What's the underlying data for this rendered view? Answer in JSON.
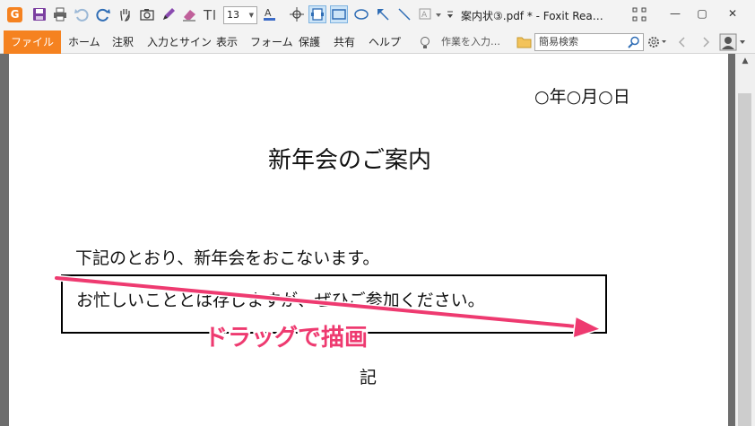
{
  "window": {
    "title": "案内状③.pdf * - Foxit Rea…",
    "font_size": "13"
  },
  "ribbon": {
    "file_tab": "ファイル",
    "tabs": [
      "ホーム",
      "注釈",
      "入力とサイン",
      "表示",
      "フォーム",
      "保護",
      "共有",
      "ヘルプ"
    ],
    "tell_me": "作業を入力…",
    "search_placeholder": "簡易検索"
  },
  "document": {
    "date": "○年○月○日",
    "title": "新年会のご案内",
    "line1": "下記のとおり、新年会をおこないます。",
    "line2": "お忙しいこととは存じますが、ぜひご参加ください。",
    "ki": "記"
  },
  "annotation": {
    "label": "ドラッグで描画",
    "color": "#ee3a70"
  },
  "colors": {
    "accent": "#f58220",
    "select_highlight": "#cce4f7"
  }
}
